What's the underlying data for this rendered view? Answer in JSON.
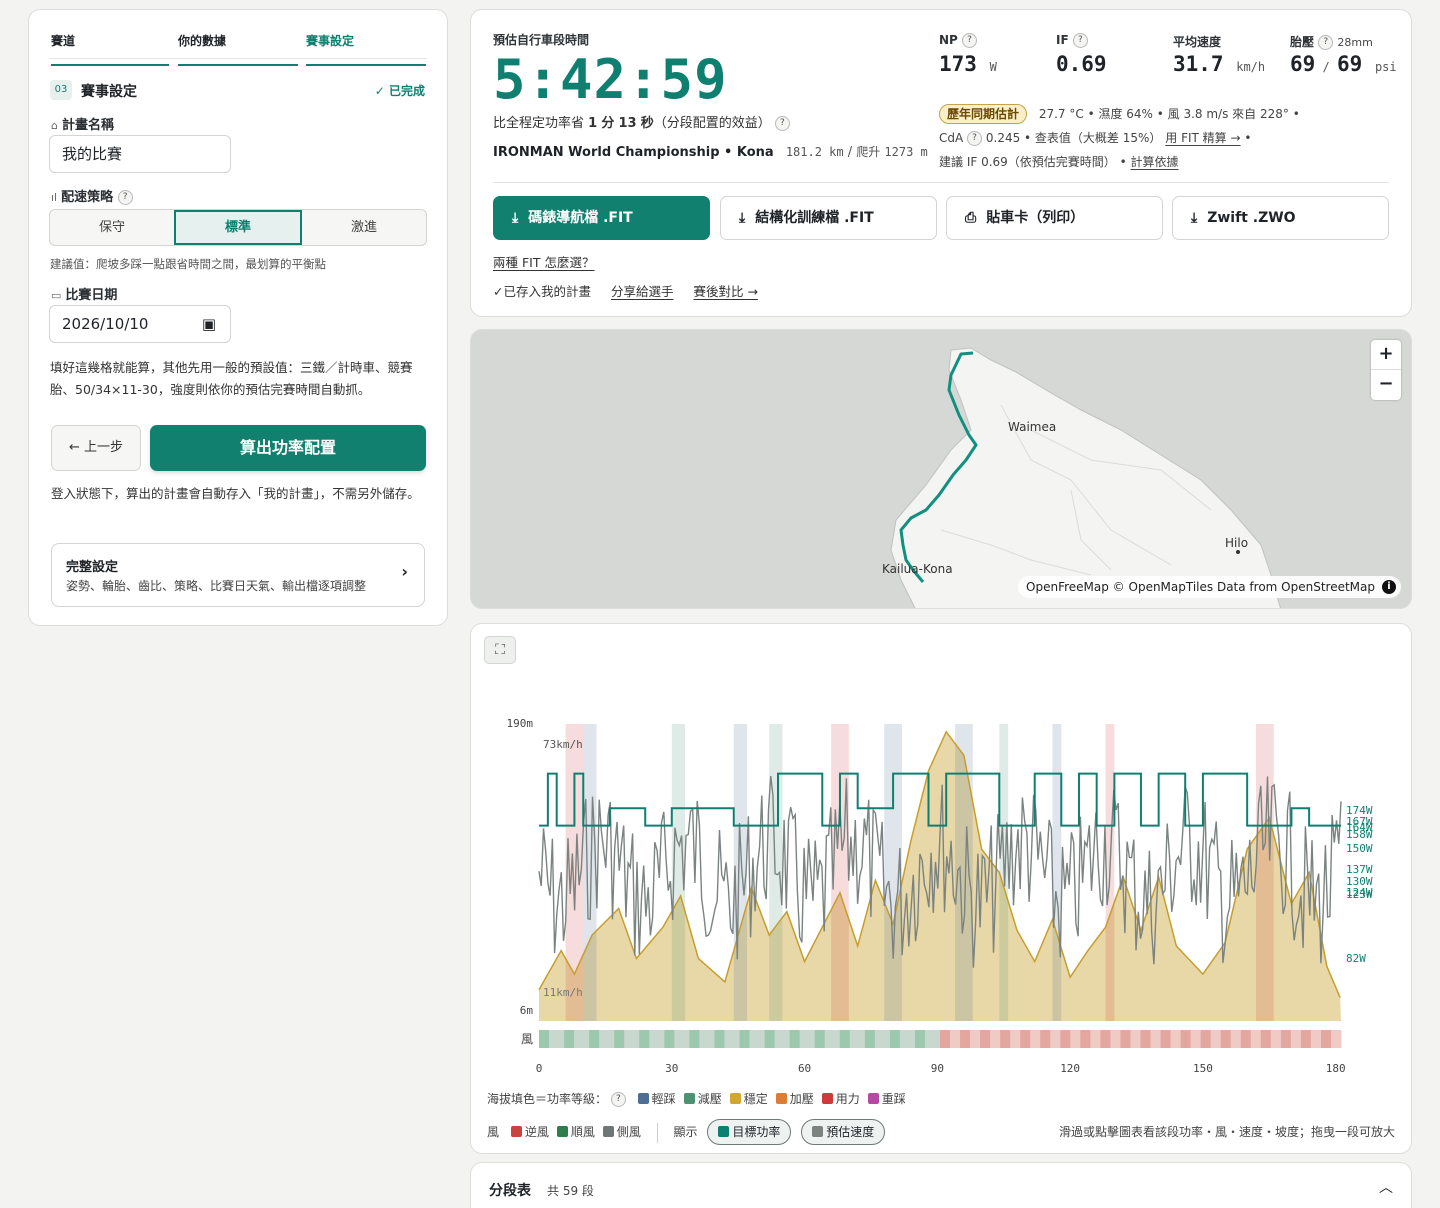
{
  "tabs": [
    {
      "label": "賽道"
    },
    {
      "label": "你的數據"
    },
    {
      "label": "賽事設定"
    }
  ],
  "section": {
    "num": "03",
    "title": "賽事設定",
    "done": "✓ 已完成"
  },
  "plan_name": {
    "label": "計畫名稱",
    "value": "我的比賽"
  },
  "pacing": {
    "label": "配速策略",
    "options": [
      "保守",
      "標準",
      "激進"
    ],
    "selected": "標準",
    "hint": "建議值：爬坡多踩一點跟省時間之間，最划算的平衡點"
  },
  "race_date": {
    "label": "比賽日期",
    "value": "2026/10/10"
  },
  "defaults_note": "填好這幾格就能算，其他先用一般的預設值：三鐵／計時車、競賽胎、50/34×11-30，強度則依你的預估完賽時間自動抓。",
  "back_label": "← 上一步",
  "calc_label": "算出功率配置",
  "login_note": "登入狀態下，算出的計畫會自動存入「我的計畫」，不需另外儲存。",
  "full_settings": {
    "title": "完整設定",
    "desc": "姿勢、輪胎、齒比、策略、比賽日天氣、輸出檔逐項調整"
  },
  "summary": {
    "time_label": "預估自行車段時間",
    "time": "5:42:59",
    "save_pre": "比全程定功率省",
    "save_min": "1",
    "save_min_u": "分",
    "save_sec": "13",
    "save_sec_u": "秒",
    "save_post": "（分段配置的效益）",
    "race_name": "IRONMAN World Championship • Kona",
    "distance": "181.2 km",
    "climb_label": "爬升",
    "climb": "1273 m",
    "np_label": "NP",
    "np": "173",
    "np_unit": "W",
    "if_label": "IF",
    "if": "0.69",
    "speed_label": "平均速度",
    "speed": "31.7",
    "speed_unit": "km/h",
    "tire_label": "胎壓",
    "tire_width": "28mm",
    "tire_front": "69",
    "tire_rear": "69",
    "tire_unit": "psi",
    "weather_tag": "歷年同期估計",
    "weather": "27.7 °C • 濕度 64% • 風 3.8 m/s 來自 228° •",
    "cda_label": "CdA",
    "cda": "0.245 • 查表值（大概差 15%）",
    "cda_link": "用 FIT 精算 →",
    "if_note": "建議 IF 0.69（依預估完賽時間）",
    "if_link": "計算依據"
  },
  "downloads": [
    {
      "label": "碼錶導航檔 .FIT",
      "icon": "download-icon"
    },
    {
      "label": "結構化訓練檔 .FIT",
      "icon": "download-icon"
    },
    {
      "label": "貼車卡（列印）",
      "icon": "printer-icon"
    },
    {
      "label": "Zwift .ZWO",
      "icon": "download-icon"
    }
  ],
  "fit_help": "兩種 FIT 怎麼選？",
  "saved": "✓已存入我的計畫",
  "share": "分享給選手",
  "compare": "賽後對比 →",
  "map": {
    "labels": [
      "Waimea",
      "Hilo",
      "Kailua-Kona"
    ],
    "zoom_in": "+",
    "zoom_out": "−",
    "attribution": "OpenFreeMap © OpenMapTiles Data from OpenStreetMap",
    "info": "i"
  },
  "chart_data": {
    "type": "area",
    "x_ticks": [
      "0",
      "30",
      "60",
      "90",
      "120",
      "150",
      "180"
    ],
    "xlim": [
      0,
      181.2
    ],
    "elev_top": "190m",
    "elev_bottom": "6m",
    "speed_top": "73km/h",
    "speed_bottom": "11km/h",
    "wind_label": "風",
    "power_labels": [
      "174W",
      "167W",
      "164W",
      "158W",
      "150W",
      "137W",
      "130W",
      "124W",
      "123W",
      "82W"
    ],
    "elevation": [
      [
        0,
        20
      ],
      [
        5,
        45
      ],
      [
        8,
        30
      ],
      [
        12,
        55
      ],
      [
        18,
        72
      ],
      [
        22,
        40
      ],
      [
        28,
        60
      ],
      [
        32,
        80
      ],
      [
        36,
        40
      ],
      [
        42,
        25
      ],
      [
        48,
        85
      ],
      [
        52,
        55
      ],
      [
        56,
        70
      ],
      [
        60,
        38
      ],
      [
        64,
        60
      ],
      [
        68,
        82
      ],
      [
        72,
        48
      ],
      [
        76,
        90
      ],
      [
        80,
        62
      ],
      [
        84,
        115
      ],
      [
        88,
        160
      ],
      [
        92,
        185
      ],
      [
        96,
        170
      ],
      [
        100,
        110
      ],
      [
        104,
        95
      ],
      [
        108,
        58
      ],
      [
        112,
        38
      ],
      [
        116,
        65
      ],
      [
        120,
        28
      ],
      [
        124,
        45
      ],
      [
        128,
        60
      ],
      [
        132,
        92
      ],
      [
        136,
        58
      ],
      [
        140,
        92
      ],
      [
        144,
        48
      ],
      [
        150,
        30
      ],
      [
        155,
        50
      ],
      [
        160,
        110
      ],
      [
        165,
        130
      ],
      [
        170,
        75
      ],
      [
        174,
        95
      ],
      [
        178,
        35
      ],
      [
        181,
        15
      ]
    ],
    "target_power": [
      [
        0,
        150
      ],
      [
        2,
        174
      ],
      [
        4,
        150
      ],
      [
        8,
        174
      ],
      [
        10,
        150
      ],
      [
        14,
        150
      ],
      [
        16,
        158
      ],
      [
        20,
        158
      ],
      [
        24,
        150
      ],
      [
        28,
        150
      ],
      [
        30,
        158
      ],
      [
        40,
        158
      ],
      [
        44,
        150
      ],
      [
        50,
        150
      ],
      [
        54,
        174
      ],
      [
        60,
        174
      ],
      [
        64,
        150
      ],
      [
        68,
        174
      ],
      [
        72,
        158
      ],
      [
        80,
        174
      ],
      [
        88,
        150
      ],
      [
        92,
        174
      ],
      [
        100,
        174
      ],
      [
        104,
        150
      ],
      [
        108,
        150
      ],
      [
        112,
        174
      ],
      [
        118,
        150
      ],
      [
        122,
        174
      ],
      [
        126,
        150
      ],
      [
        130,
        174
      ],
      [
        136,
        150
      ],
      [
        140,
        174
      ],
      [
        146,
        150
      ],
      [
        150,
        174
      ],
      [
        160,
        150
      ],
      [
        170,
        158
      ],
      [
        174,
        150
      ],
      [
        181,
        150
      ]
    ],
    "legend_title": "海拔填色＝功率等級：",
    "legend": [
      {
        "name": "輕踩",
        "color": "#4d6f91"
      },
      {
        "name": "減壓",
        "color": "#4d9274"
      },
      {
        "name": "穩定",
        "color": "#d1a732"
      },
      {
        "name": "加壓",
        "color": "#dc7d36"
      },
      {
        "name": "用力",
        "color": "#cf3b3b"
      },
      {
        "name": "重踩",
        "color": "#b54aa5"
      }
    ],
    "wind_legend": [
      {
        "name": "逆風",
        "color": "#c8453f"
      },
      {
        "name": "順風",
        "color": "#2e7d4f"
      },
      {
        "name": "側風",
        "color": "#6f7776"
      }
    ],
    "show_label": "顯示",
    "show_options": [
      "目標功率",
      "預估速度"
    ],
    "hint": "滑過或點擊圖表看該段功率・風・速度・坡度；拖曳一段可放大"
  },
  "segments": {
    "title": "分段表",
    "count": "共 59 段"
  }
}
